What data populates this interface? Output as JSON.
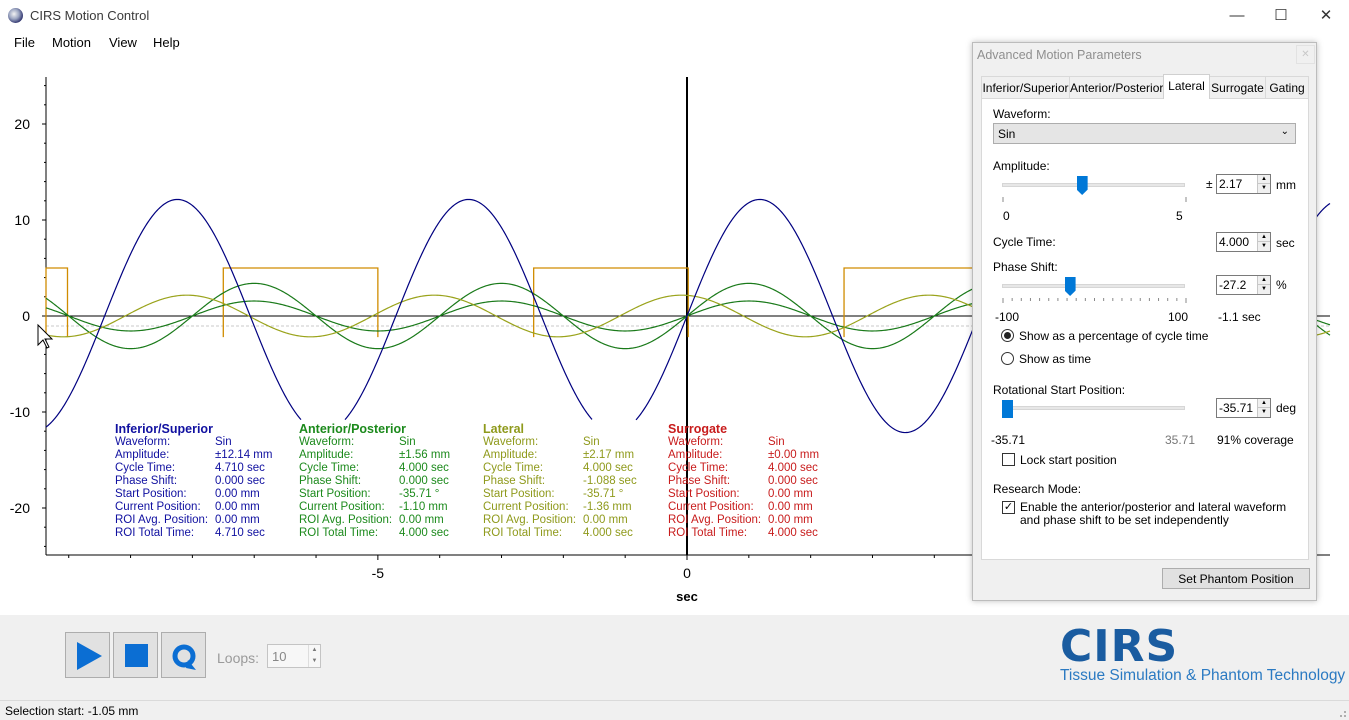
{
  "window": {
    "title": "CIRS Motion Control",
    "icons": {
      "app": "cirs-sphere-icon",
      "minimize": "minimize-icon",
      "maximize": "maximize-icon",
      "close": "close-icon"
    }
  },
  "menu": [
    "File",
    "Motion",
    "View",
    "Help"
  ],
  "plot": {
    "xlabel": "sec",
    "x_ticks": [
      "-5",
      "0"
    ],
    "y_ticks": [
      "20",
      "10",
      "0",
      "-10",
      "-20"
    ],
    "colors": {
      "inferior_superior": "#000080",
      "anterior_posterior": "#1a7a1a",
      "lateral": "#9aa31b",
      "surrogate": "#d08c00"
    }
  },
  "chart_data": {
    "type": "line",
    "title": "",
    "xlabel": "sec",
    "ylabel": "",
    "xlim": [
      -10.5,
      10.5
    ],
    "ylim": [
      -25,
      25
    ],
    "grid": false,
    "series": [
      {
        "name": "Inferior/Superior",
        "waveform": "Sin",
        "amplitude": 12.14,
        "period": 4.71,
        "phase": 0.0
      },
      {
        "name": "Anterior/Posterior",
        "waveform": "Sin",
        "amplitude": 1.56,
        "period": 4.0,
        "phase": 0.0
      },
      {
        "name": "Lateral",
        "waveform": "Sin",
        "amplitude": 2.17,
        "period": 4.0,
        "phase": -1.088
      },
      {
        "name": "Surrogate",
        "waveform": "Sin",
        "amplitude": 0.0,
        "period": 4.0,
        "phase": 0.0
      }
    ]
  },
  "info": [
    {
      "title": "Inferior/Superior",
      "color": "#1010a0",
      "rows": [
        [
          "Waveform:",
          "Sin"
        ],
        [
          "Amplitude:",
          "±12.14 mm"
        ],
        [
          "Cycle Time:",
          "4.710 sec"
        ],
        [
          "Phase Shift:",
          "0.000 sec"
        ],
        [
          "Start Position:",
          "0.00 mm"
        ],
        [
          "Current Position:",
          "0.00 mm"
        ],
        [
          "ROI Avg. Position:",
          "0.00 mm"
        ],
        [
          "ROI Total Time:",
          "4.710 sec"
        ]
      ]
    },
    {
      "title": "Anterior/Posterior",
      "color": "#1c8a1c",
      "rows": [
        [
          "Waveform:",
          "Sin"
        ],
        [
          "Amplitude:",
          "±1.56 mm"
        ],
        [
          "Cycle Time:",
          "4.000 sec"
        ],
        [
          "Phase Shift:",
          "0.000 sec"
        ],
        [
          "Start Position:",
          "-35.71 °"
        ],
        [
          "Current Position:",
          "-1.10 mm"
        ],
        [
          "ROI Avg. Position:",
          "0.00 mm"
        ],
        [
          "ROI Total Time:",
          "4.000 sec"
        ]
      ]
    },
    {
      "title": "Lateral",
      "color": "#8f9a1c",
      "rows": [
        [
          "Waveform:",
          "Sin"
        ],
        [
          "Amplitude:",
          "±2.17 mm"
        ],
        [
          "Cycle Time:",
          "4.000 sec"
        ],
        [
          "Phase Shift:",
          "-1.088 sec"
        ],
        [
          "Start Position:",
          "-35.71 °"
        ],
        [
          "Current Position:",
          "-1.36 mm"
        ],
        [
          "ROI Avg. Position:",
          "0.00 mm"
        ],
        [
          "ROI Total Time:",
          "4.000 sec"
        ]
      ]
    },
    {
      "title": "Surrogate",
      "color": "#c81c1c",
      "rows": [
        [
          "Waveform:",
          "Sin"
        ],
        [
          "Amplitude:",
          "±0.00 mm"
        ],
        [
          "Cycle Time:",
          "4.000 sec"
        ],
        [
          "Phase Shift:",
          "0.000 sec"
        ],
        [
          "Start Position:",
          "0.00 mm"
        ],
        [
          "Current Position:",
          "0.00 mm"
        ],
        [
          "ROI Avg. Position:",
          "0.00 mm"
        ],
        [
          "ROI Total Time:",
          "4.000 sec"
        ]
      ]
    }
  ],
  "controls": {
    "loops_label": "Loops:",
    "loops_value": "10",
    "icons": {
      "play": "play-icon",
      "stop": "stop-icon",
      "loop": "loop-icon"
    }
  },
  "logo": {
    "main": "CIRS",
    "sub": "Tissue Simulation & Phantom Technology"
  },
  "status": {
    "text": "Selection start: -1.05 mm"
  },
  "dialog": {
    "title": "Advanced Motion Parameters",
    "tabs": [
      "Inferior/Superior",
      "Anterior/Posterior",
      "Lateral",
      "Surrogate",
      "Gating"
    ],
    "active_tab": "Lateral",
    "waveform_label": "Waveform:",
    "waveform_value": "Sin",
    "amplitude_label": "Amplitude:",
    "amplitude_pm": "±",
    "amplitude_value": "2.17",
    "amplitude_unit": "mm",
    "amplitude_min": "0",
    "amplitude_max": "5",
    "amplitude_slider_fraction": 0.434,
    "cycle_label": "Cycle Time:",
    "cycle_value": "4.000",
    "cycle_unit": "sec",
    "phase_label": "Phase Shift:",
    "phase_value": "-27.2",
    "phase_unit": "%",
    "phase_min": "-100",
    "phase_max": "100",
    "phase_sec": "-1.1 sec",
    "phase_slider_fraction": 0.364,
    "radio_percent": "Show as a percentage of cycle time",
    "radio_time": "Show as time",
    "rot_label": "Rotational Start Position:",
    "rot_value": "-35.71",
    "rot_unit": "deg",
    "rot_min": "-35.71",
    "rot_max": "35.71",
    "rot_coverage": "91% coverage",
    "rot_slider_fraction": 0.0,
    "lock_label": "Lock start position",
    "research_label": "Research Mode:",
    "research_check_label": "Enable the anterior/posterior and lateral waveform and phase shift to be set independently",
    "set_phantom_button": "Set Phantom Position"
  }
}
